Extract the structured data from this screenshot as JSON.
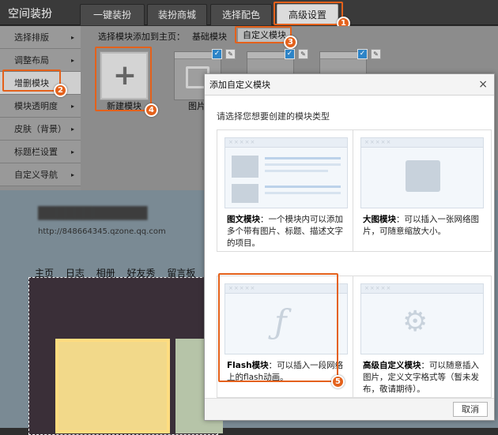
{
  "app": {
    "title": "空间装扮"
  },
  "tabs": [
    {
      "label": "一键装扮"
    },
    {
      "label": "装扮商城"
    },
    {
      "label": "选择配色"
    },
    {
      "label": "高级设置"
    }
  ],
  "sidebar": {
    "items": [
      {
        "label": "选择排版"
      },
      {
        "label": "调整布局"
      },
      {
        "label": "增删模块"
      },
      {
        "label": "模块透明度"
      },
      {
        "label": "皮肤（背景）"
      },
      {
        "label": "标题栏设置"
      },
      {
        "label": "自定义导航"
      }
    ],
    "arrow": "▸"
  },
  "module_panel": {
    "label": "选择模块添加到主页：",
    "tab_basic": "基础模块",
    "tab_custom": "自定义模块",
    "new_module": "新建模块",
    "thumb_label": "图片"
  },
  "page": {
    "url": "http://848664345.qzone.qq.com",
    "nav": [
      "主页",
      "日志",
      "相册",
      "好友秀",
      "留言板"
    ]
  },
  "dialog": {
    "title": "添加自定义模块",
    "close": "×",
    "prompt": "请选择您想要创建的模块类型",
    "cards": [
      {
        "title": "图文模块",
        "desc": "：一个模块内可以添加多个带有图片、标题、描述文字的项目。"
      },
      {
        "title": "大图模块",
        "desc": "：可以插入一张网络图片，可随意缩放大小。"
      },
      {
        "title": "Flash模块",
        "desc": "：可以插入一段网络上的flash动画。"
      },
      {
        "title": "高级自定义模块",
        "desc": "：可以随意插入图片，定义文字格式等（暂未发布，敬请期待）。"
      }
    ],
    "cancel": "取消"
  },
  "badges": [
    "1",
    "2",
    "3",
    "4",
    "5"
  ],
  "colors": {
    "accent": "#e4611b",
    "check_blue": "#2d84c7"
  },
  "icons": {
    "new_module": "plus-icon",
    "thumb_check": "checkmark-icon",
    "thumb_edit": "pencil-icon"
  }
}
